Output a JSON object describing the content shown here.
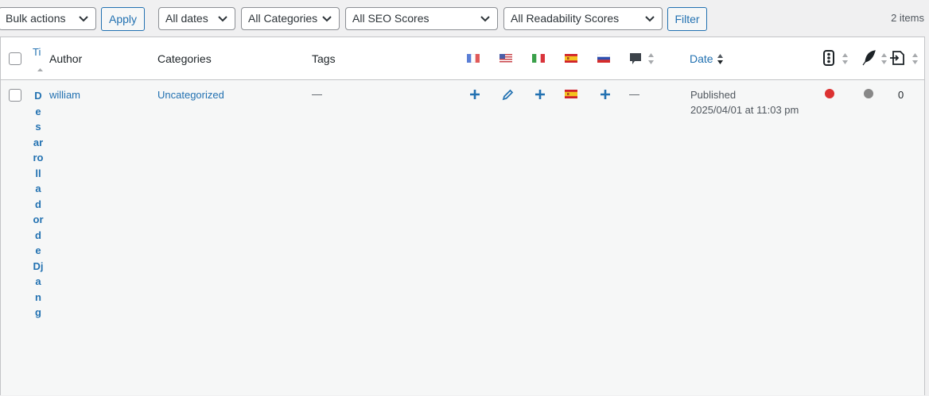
{
  "toolbar": {
    "bulk_actions": "Bulk actions",
    "apply": "Apply",
    "dates": "All dates",
    "categories": "All Categories",
    "seo": "All SEO Scores",
    "readability": "All Readability Scores",
    "filter": "Filter",
    "items_count": "2 items"
  },
  "columns": {
    "title": "Ti",
    "author": "Author",
    "categories": "Categories",
    "tags": "Tags",
    "date": "Date"
  },
  "language_flags": [
    "fr",
    "us",
    "it",
    "es",
    "ru"
  ],
  "row": {
    "title": "DesarrolladordeDjang",
    "author": "william",
    "category": "Uncategorized",
    "tags": "—",
    "comments": "—",
    "status": "Published",
    "date": "2025/04/01 at 11:03 pm",
    "links_count": "0",
    "translations": [
      {
        "lang": "fr",
        "state": "add",
        "icon": "plus-icon"
      },
      {
        "lang": "us",
        "state": "edit",
        "icon": "pencil-icon"
      },
      {
        "lang": "it",
        "state": "add",
        "icon": "plus-icon"
      },
      {
        "lang": "es",
        "state": "current",
        "icon": "flag-es-icon"
      },
      {
        "lang": "ru",
        "state": "add",
        "icon": "plus-icon"
      }
    ],
    "seo_score_color": "#dc3232",
    "readability_score_color": "#888888"
  },
  "colors": {
    "link": "#2271b1",
    "background": "#f0f0f1"
  }
}
